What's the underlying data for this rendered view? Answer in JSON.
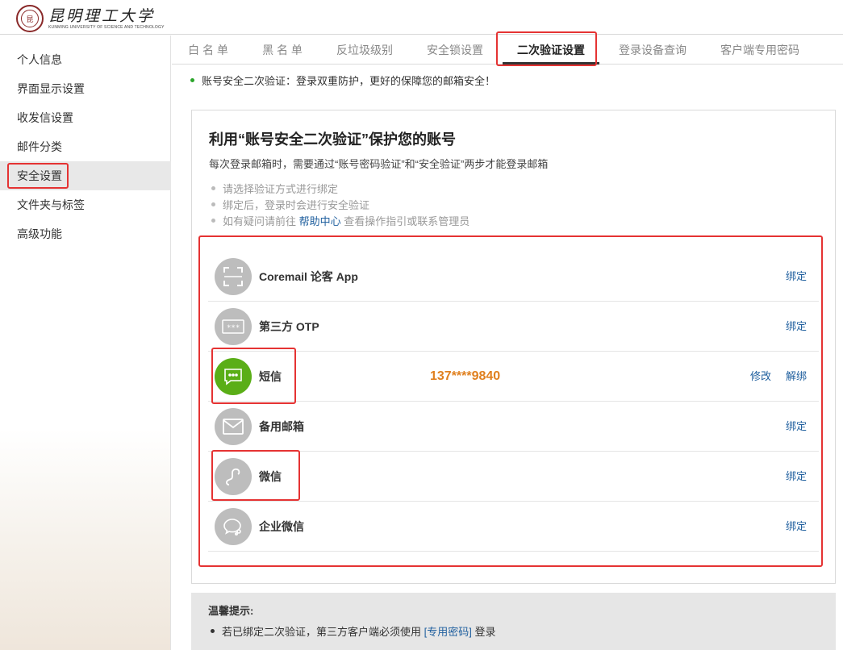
{
  "brand": {
    "name_cn": "昆明理工大学",
    "name_en": "KUNMING UNIVERSITY OF SCIENCE AND TECHNOLOGY",
    "seal_glyph": "昆"
  },
  "sidebar": {
    "items": [
      {
        "label": "个人信息"
      },
      {
        "label": "界面显示设置"
      },
      {
        "label": "收发信设置"
      },
      {
        "label": "邮件分类"
      },
      {
        "label": "安全设置",
        "active": true
      },
      {
        "label": "文件夹与标签"
      },
      {
        "label": "高级功能"
      }
    ]
  },
  "tabs": [
    {
      "label": "白 名 单"
    },
    {
      "label": "黑 名 单"
    },
    {
      "label": "反垃圾级别"
    },
    {
      "label": "安全锁设置"
    },
    {
      "label": "二次验证设置",
      "active": true
    },
    {
      "label": "登录设备查询"
    },
    {
      "label": "客户端专用密码"
    }
  ],
  "notice": "账号安全二次验证：登录双重防护，更好的保障您的邮箱安全！",
  "panel": {
    "title": "利用“账号安全二次验证”保护您的账号",
    "subtitle": "每次登录邮箱时，需要通过“账号密码验证”和“安全验证”两步才能登录邮箱",
    "hints": {
      "h1": "请选择验证方式进行绑定",
      "h2": "绑定后，登录时会进行安全验证",
      "h3_pre": "如有疑问请前往 ",
      "h3_link": "帮助中心",
      "h3_post": " 查看操作指引或联系管理员"
    }
  },
  "methods": {
    "coremail": {
      "name": "Coremail 论客 App",
      "action": "绑定",
      "icon": "scan-icon"
    },
    "otp": {
      "name": "第三方 OTP",
      "action": "绑定",
      "icon": "otp-code-icon",
      "icon_text": "*** "
    },
    "sms": {
      "name": "短信",
      "phone": "137****9840",
      "modify": "修改",
      "unbind": "解绑",
      "icon": "sms-icon",
      "icon_color": "#5aae17"
    },
    "email": {
      "name": "备用邮箱",
      "action": "绑定",
      "icon": "envelope-icon"
    },
    "wechat": {
      "name": "微信",
      "action": "绑定",
      "icon": "wechat-icon"
    },
    "wework": {
      "name": "企业微信",
      "action": "绑定",
      "icon": "wework-icon"
    }
  },
  "tips": {
    "title": "温馨提示:",
    "line_pre": "若已绑定二次验证，第三方客户端必须使用 ",
    "line_link": "[专用密码]",
    "line_post": " 登录"
  },
  "colors": {
    "highlight": "#e53333",
    "link": "#1f5f9e",
    "phone": "#e0801f",
    "sms_green": "#5aae17",
    "icon_gray": "#bdbdbd"
  }
}
